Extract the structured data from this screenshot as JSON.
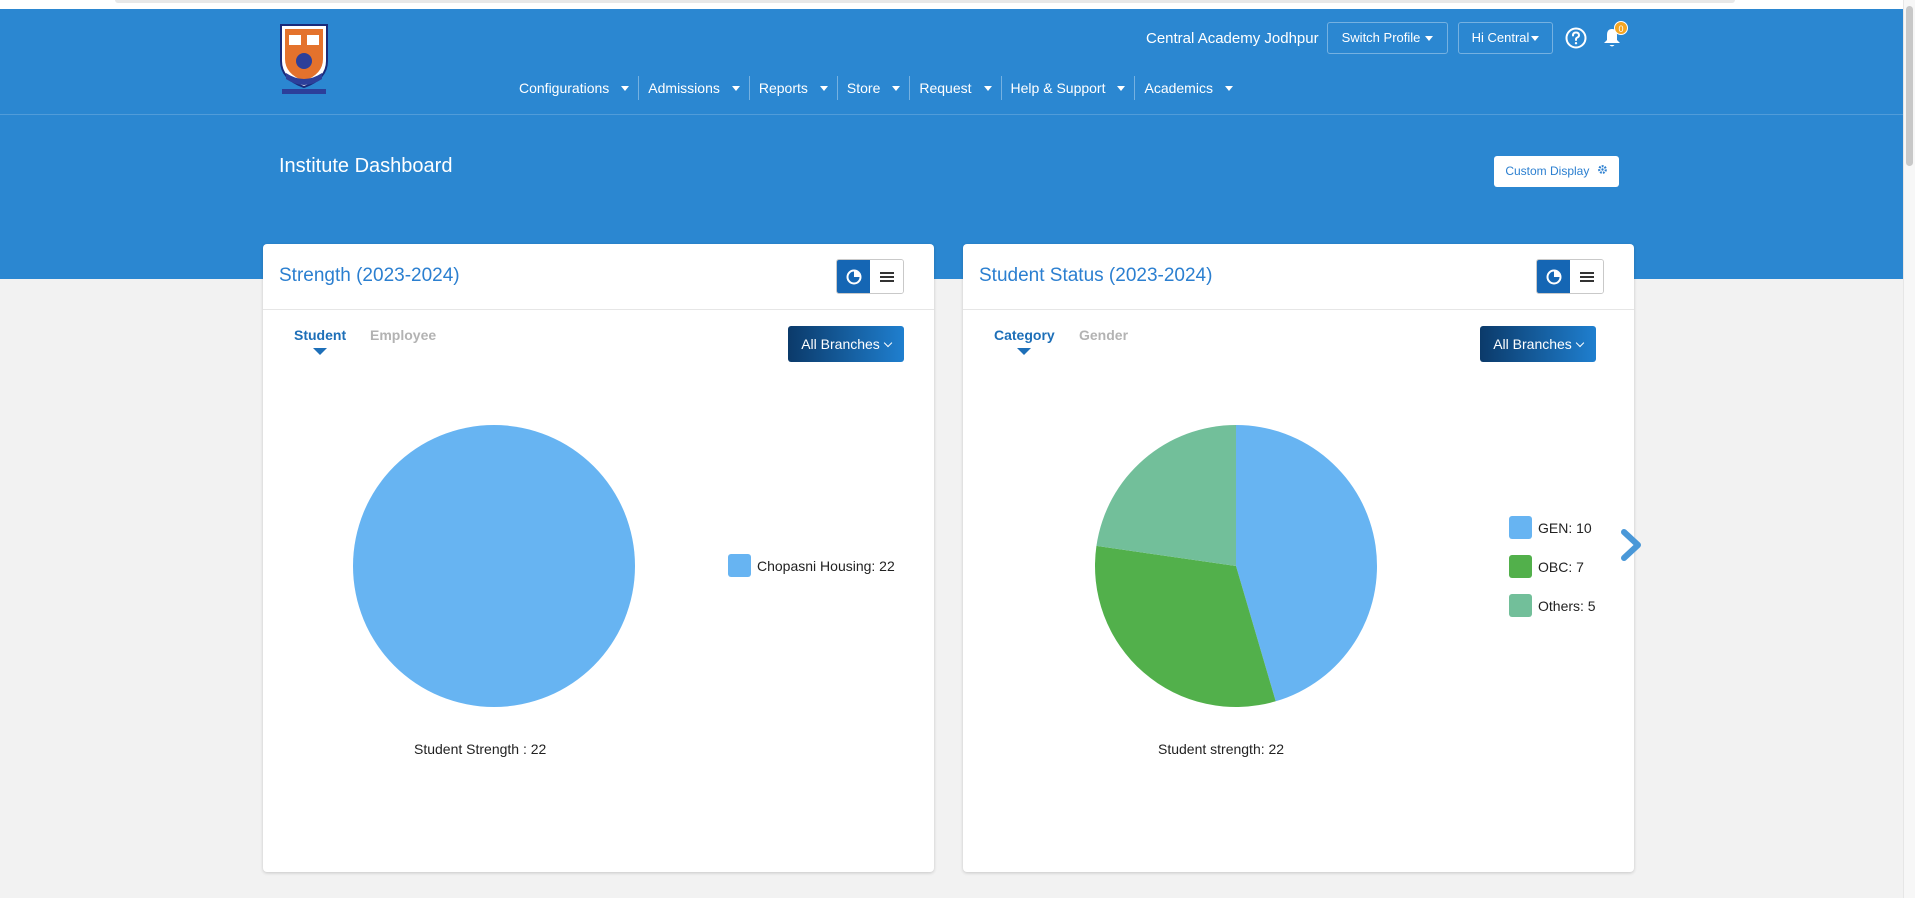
{
  "header": {
    "institute_name": "Central Academy Jodhpur",
    "switch_profile_label": "Switch Profile",
    "user_menu_label": "Hi Central",
    "notification_count": "0",
    "logo_icon": "school-crest-logo",
    "help_icon": "help-icon",
    "bell_icon": "bell-icon",
    "color": "#2b87d1"
  },
  "nav": [
    {
      "label": "Configurations"
    },
    {
      "label": "Admissions"
    },
    {
      "label": "Reports"
    },
    {
      "label": "Store"
    },
    {
      "label": "Request"
    },
    {
      "label": "Help & Support"
    },
    {
      "label": "Academics"
    }
  ],
  "page": {
    "title": "Institute Dashboard",
    "custom_display_label": "Custom Display",
    "custom_display_icon": "gear-icon"
  },
  "strength_card": {
    "title": "Strength (2023-2024)",
    "tabs": [
      {
        "label": "Student",
        "active": true
      },
      {
        "label": "Employee",
        "active": false
      }
    ],
    "branch_label": "All Branches",
    "footer": "Student Strength : 22",
    "legend": [
      {
        "label": "Chopasni Housing: 22",
        "color": "#67b4f2"
      }
    ]
  },
  "status_card": {
    "title": "Student Status (2023-2024)",
    "tabs": [
      {
        "label": "Category",
        "active": true
      },
      {
        "label": "Gender",
        "active": false
      }
    ],
    "branch_label": "All Branches",
    "footer": "Student strength: 22",
    "legend": [
      {
        "label": "GEN: 10",
        "color": "#67b4f2"
      },
      {
        "label": "OBC: 7",
        "color": "#52b04b"
      },
      {
        "label": "Others: 5",
        "color": "#72bf9a"
      }
    ],
    "next_icon": "chevron-right-icon"
  },
  "chart_data": [
    {
      "type": "pie",
      "categories": [
        "Chopasni Housing"
      ],
      "values": [
        22
      ],
      "colors": [
        "#67b4f2"
      ]
    },
    {
      "type": "pie",
      "categories": [
        "GEN",
        "OBC",
        "Others"
      ],
      "values": [
        10,
        7,
        5
      ],
      "colors": [
        "#67b4f2",
        "#52b04b",
        "#72bf9a"
      ]
    }
  ]
}
